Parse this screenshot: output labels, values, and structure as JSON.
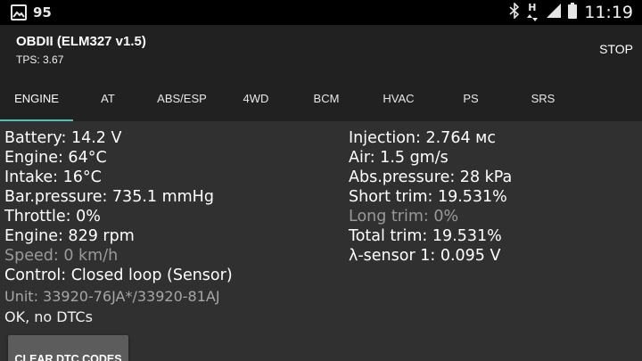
{
  "status_bar": {
    "notification_count": "95",
    "network_type": "H",
    "time": "11:19",
    "icons": [
      "gallery-icon",
      "bluetooth-icon",
      "network-arrows-icon",
      "signal-icon",
      "battery-icon"
    ]
  },
  "app_bar": {
    "title": "OBDII (ELM327 v1.5)",
    "subtitle": "TPS: 3.67",
    "stop_label": "STOP"
  },
  "tabs": [
    {
      "label": "ENGINE",
      "active": true
    },
    {
      "label": "AT"
    },
    {
      "label": "ABS/ESP"
    },
    {
      "label": "4WD"
    },
    {
      "label": "BCM"
    },
    {
      "label": "HVAC"
    },
    {
      "label": "PS"
    },
    {
      "label": "SRS"
    }
  ],
  "accent_color": "#4fc3b4",
  "readings_left": [
    {
      "text": "Battery: 14.2 V"
    },
    {
      "text": "Engine: 64°C"
    },
    {
      "text": "Intake: 16°C"
    },
    {
      "text": "Bar.pressure: 735.1 mmHg"
    },
    {
      "text": "Throttle: 0%"
    },
    {
      "text": "Engine: 829 rpm"
    },
    {
      "text": "Speed: 0 km/h",
      "dimmed": true
    },
    {
      "text": "Control: Closed loop (Sensor)"
    }
  ],
  "readings_right": [
    {
      "text": "Injection: 2.764 мс"
    },
    {
      "text": "Air: 1.5 gm/s"
    },
    {
      "text": "Abs.pressure: 28 kPa"
    },
    {
      "text": "Short trim: 19.531%"
    },
    {
      "text": "Long trim: 0%",
      "dimmed": true
    },
    {
      "text": "Total trim: 19.531%"
    },
    {
      "text": "λ-sensor 1: 0.095 V"
    }
  ],
  "unit_text": "Unit: 33920-76JA*/33920-81AJ",
  "dtc_status": "OK, no DTCs",
  "clear_button_label": "CLEAR DTC CODES"
}
